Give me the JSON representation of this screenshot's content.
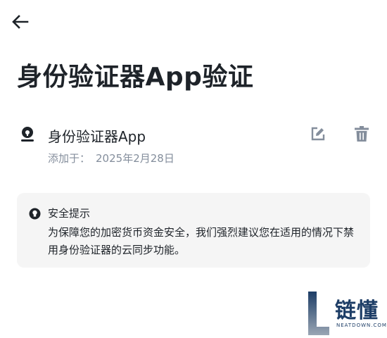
{
  "header": {
    "title": "身份验证器App验证"
  },
  "authenticator": {
    "name": "身份验证器App",
    "added_label": "添加于：",
    "added_date": "2025年2月28日"
  },
  "tip": {
    "title": "安全提示",
    "body": "为保障您的加密货币资金安全，我们强烈建议您在适用的情况下禁用身份验证器的云同步功能。"
  },
  "watermark": {
    "brand": "链懂",
    "domain": "NEATDOWN.COM"
  },
  "colors": {
    "text": "#1e2329",
    "secondary": "#848e9c",
    "card_bg": "#f5f5f5",
    "icon_gray": "#848e9c",
    "brand": "#1d3d66"
  },
  "icons": [
    "arrow-left-icon",
    "authenticator-icon",
    "edit-icon",
    "trash-icon",
    "lightbulb-icon"
  ]
}
